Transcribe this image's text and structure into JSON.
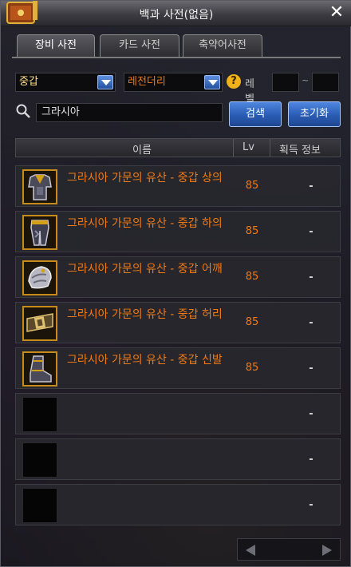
{
  "window": {
    "title": "백과 사전(없음)",
    "close_label": "✕"
  },
  "tabs": [
    {
      "label": "장비 사전",
      "active": true
    },
    {
      "label": "카드 사전",
      "active": false
    },
    {
      "label": "축약어사전",
      "active": false
    }
  ],
  "filters": {
    "type_value": "중갑",
    "rarity_value": "레전더리",
    "help_label": "?",
    "level_label": "레벨",
    "level_min": "",
    "level_max": "",
    "range_separator": "~"
  },
  "search": {
    "value": "그라시아",
    "search_button": "검색",
    "reset_button": "초기화"
  },
  "table": {
    "headers": {
      "name": "이름",
      "level": "Lv",
      "info": "획득 정보"
    },
    "rows": [
      {
        "name": "그라시아 가문의 유산 - 중갑 상의",
        "level": "85",
        "info": "-",
        "icon": "heavy-armor-top-icon"
      },
      {
        "name": "그라시아 가문의 유산 - 중갑 하의",
        "level": "85",
        "info": "-",
        "icon": "heavy-armor-bottom-icon"
      },
      {
        "name": "그라시아 가문의 유산 - 중갑 어깨",
        "level": "85",
        "info": "-",
        "icon": "heavy-armor-shoulder-icon"
      },
      {
        "name": "그라시아 가문의 유산 - 중갑 허리",
        "level": "85",
        "info": "-",
        "icon": "heavy-armor-belt-icon"
      },
      {
        "name": "그라시아 가문의 유산 - 중갑 신발",
        "level": "85",
        "info": "-",
        "icon": "heavy-armor-shoes-icon"
      },
      {
        "name": "",
        "level": "",
        "info": "-",
        "icon": ""
      },
      {
        "name": "",
        "level": "",
        "info": "-",
        "icon": ""
      },
      {
        "name": "",
        "level": "",
        "info": "-",
        "icon": ""
      }
    ]
  },
  "colors": {
    "item_name": "#f07a14",
    "button_blue": "#2a5cb4",
    "help_yellow": "#f0b21a"
  },
  "icons": {
    "window": "book-icon",
    "search": "magnifier-icon",
    "pager_prev": "triangle-left-icon",
    "pager_next": "triangle-right-icon"
  }
}
